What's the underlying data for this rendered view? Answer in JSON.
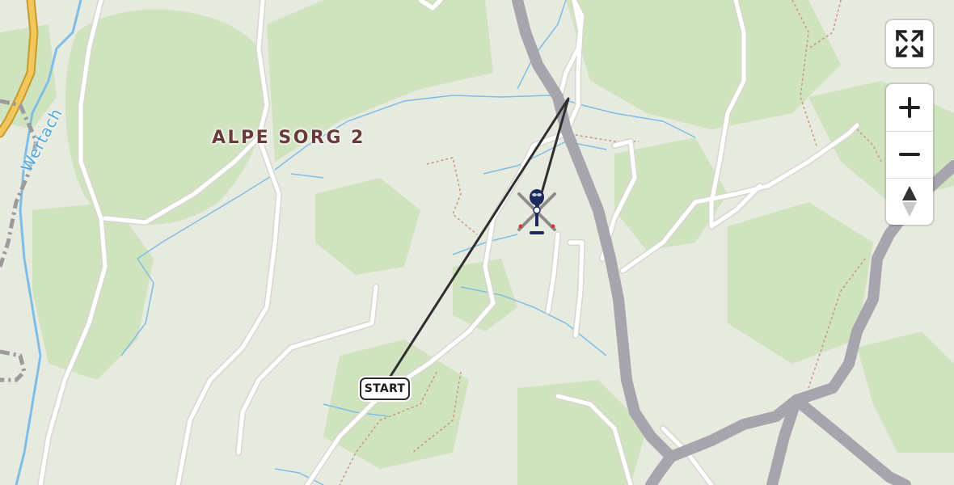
{
  "map": {
    "place_label": "ALPE SORG 2",
    "river_label": "Wertach",
    "start_label": "START",
    "icons": {
      "aircraft": "helicopter-icon",
      "fullscreen": "fullscreen-icon",
      "zoom_in": "plus-icon",
      "zoom_out": "minus-icon",
      "compass": "compass-north-icon"
    },
    "colors": {
      "background": "#e7eadf",
      "forest": "#cfe3bf",
      "road": "#ffffff",
      "road_casing": "#d7d7cf",
      "highway": "#a6a4ad",
      "major_road": "#f1c65a",
      "water": "#7fbde8",
      "path": "#c99a80",
      "railway": "#9b9b9b",
      "flight_track": "#2f2f2f",
      "helicopter_body": "#1e2a5c",
      "helicopter_rotor_tip": "#d23a3a"
    }
  }
}
